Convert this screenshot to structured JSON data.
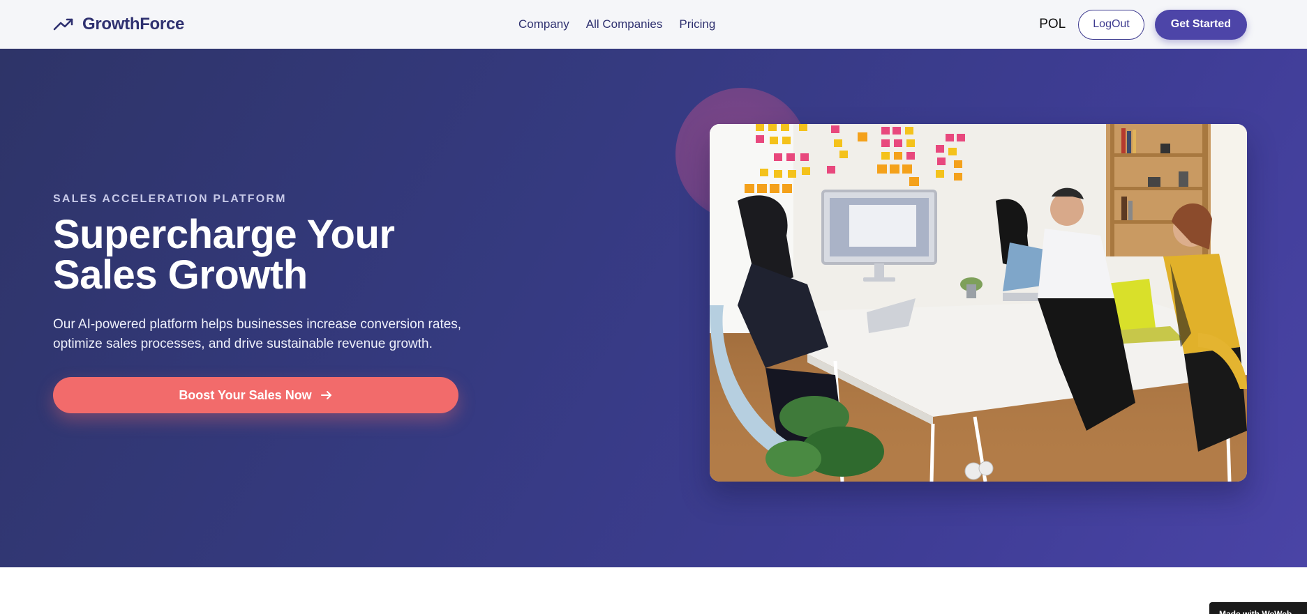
{
  "header": {
    "brand": "GrowthForce",
    "brand_icon": "trending-up-icon",
    "nav": [
      "Company",
      "All Companies",
      "Pricing"
    ],
    "language": "POL",
    "logout_label": "LogOut",
    "get_started_label": "Get Started"
  },
  "hero": {
    "eyebrow": "SALES ACCELERATION PLATFORM",
    "headline_line1": "Supercharge Your",
    "headline_line2": "Sales Growth",
    "subtext": "Our AI-powered platform helps businesses increase conversion rates, optimize sales processes, and drive sustainable revenue growth.",
    "cta_label": "Boost Your Sales Now",
    "cta_icon": "arrow-right-icon"
  },
  "footer_badge": "Made with WeWeb",
  "colors": {
    "brand_text": "#2f3170",
    "primary": "#4d45a8",
    "cta": "#f26b6b",
    "hero_bg_start": "#2e3468",
    "hero_bg_end": "#4a44a6"
  }
}
